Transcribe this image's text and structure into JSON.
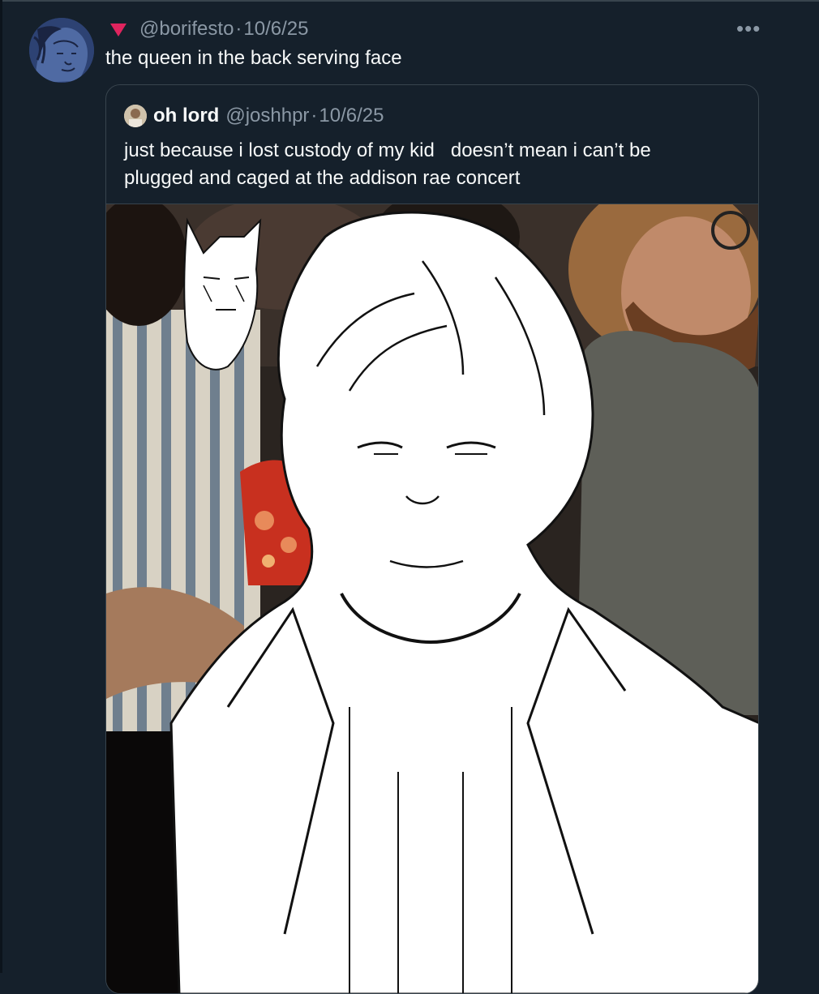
{
  "tweet": {
    "handle": "@borifesto",
    "separator": "·",
    "date": "10/6/25",
    "text": "the queen in the back serving face",
    "more_icon": "•••",
    "flag_icon": "red-triangle-flag-icon",
    "avatar_icon": "drawn-portrait-avatar"
  },
  "quote": {
    "name": "oh lord",
    "handle": "@joshhpr",
    "separator": "·",
    "date": "10/6/25",
    "line1": "just because i lost custody of my kid   doesn’t mean i can’t be",
    "line2": "plugged and caged at the addison rae concert",
    "avatar_icon": "user-photo-avatar",
    "media_description_icon": "concert-crowd-photo-with-drawn-characters"
  },
  "colors": {
    "background": "#15202b",
    "border": "#38444d",
    "text_primary": "#f7f9f9",
    "text_secondary": "#8b98a5",
    "flag": "#e0245e"
  }
}
